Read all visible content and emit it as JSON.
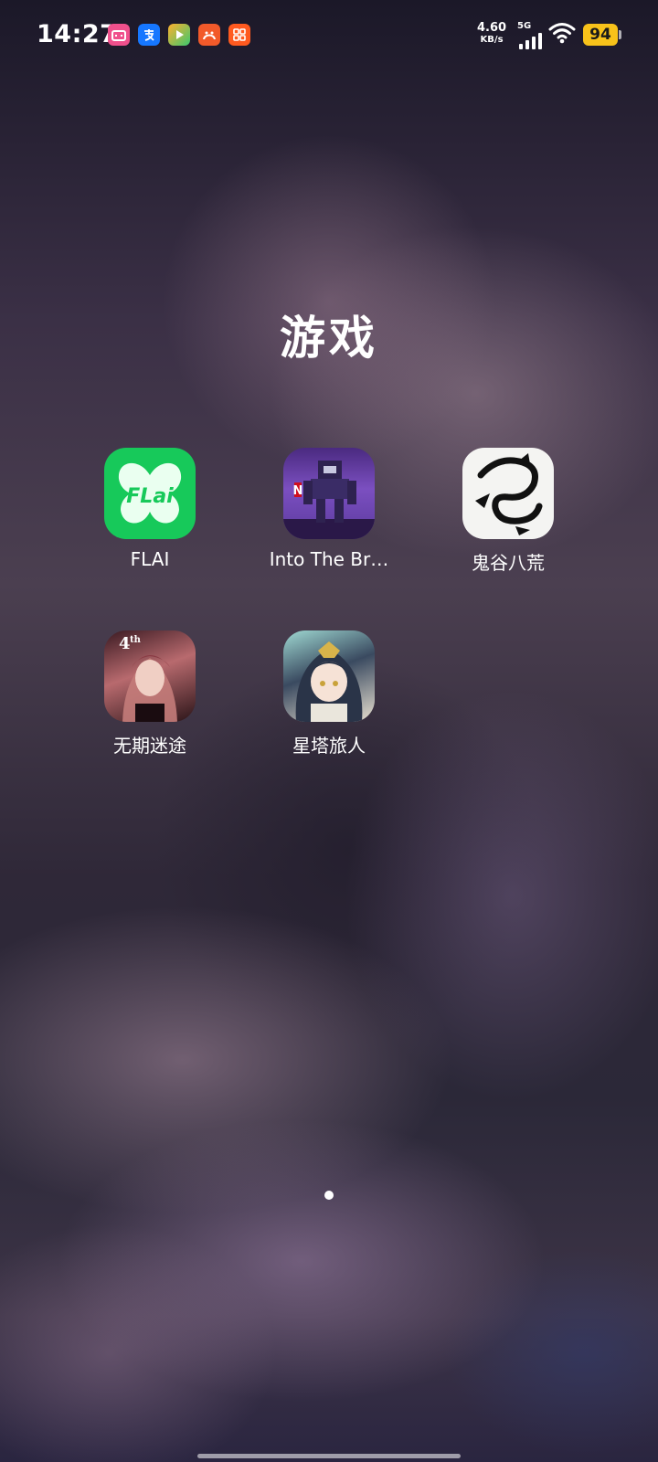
{
  "status_bar": {
    "time": "14:27",
    "notification_icons": [
      "bilibili-icon",
      "alipay-icon",
      "video-app-icon",
      "taobao-icon",
      "taobao-grid-icon"
    ],
    "net_speed_value": "4.60",
    "net_speed_unit": "KB/s",
    "network_type": "5G",
    "battery_level": "94",
    "colors": {
      "battery": "#f8c21a"
    }
  },
  "folder": {
    "title": "游戏",
    "apps": [
      {
        "label": "FLAI",
        "icon": "flai-icon"
      },
      {
        "label": "Into The Br…",
        "icon": "into-the-breach-icon"
      },
      {
        "label": "鬼谷八荒",
        "icon": "guigubahuang-icon"
      },
      {
        "label": "无期迷途",
        "icon": "wuqimitu-icon"
      },
      {
        "label": "星塔旅人",
        "icon": "xingtalvren-icon"
      }
    ]
  },
  "pager": {
    "current_page": 1,
    "total_pages": 1
  }
}
